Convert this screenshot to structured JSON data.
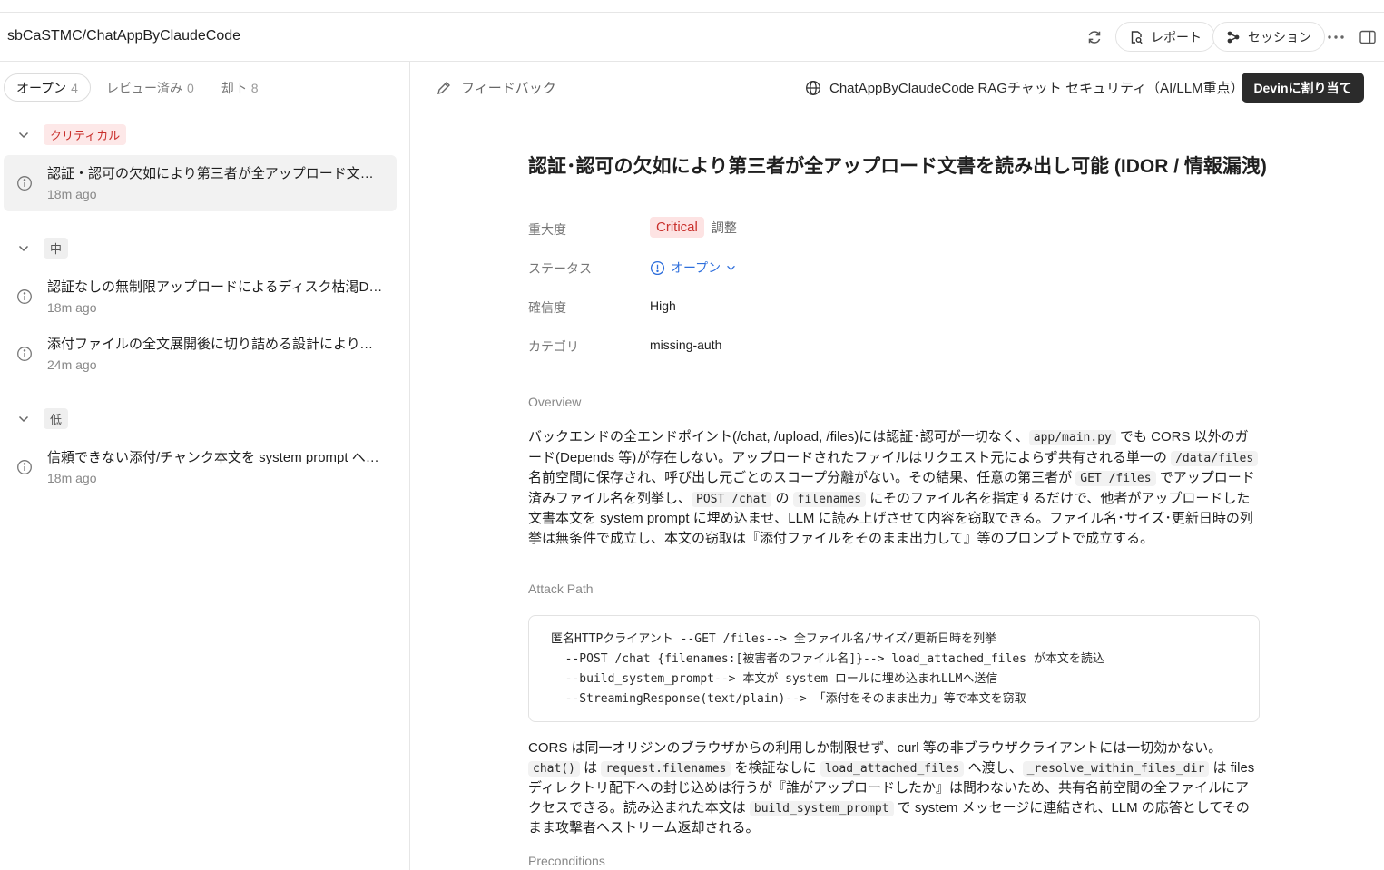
{
  "header": {
    "repo": "sbCaSTMC/ChatAppByClaudeCode",
    "report_label": "レポート",
    "session_label": "セッション"
  },
  "sidebar": {
    "tabs": [
      {
        "label": "オープン",
        "count": "4"
      },
      {
        "label": "レビュー済み",
        "count": "0"
      },
      {
        "label": "却下",
        "count": "8"
      }
    ],
    "groups": [
      {
        "label": "クリティカル",
        "items": [
          {
            "title": "認証・認可の欠如により第三者が全アップロード文書を読み出し可能 (IDOR / 情報漏洩)",
            "time": "18m ago"
          }
        ]
      },
      {
        "label": "中",
        "items": [
          {
            "title": "認証なしの無制限アップロードによるディスク枯渇DoS",
            "time": "18m ago"
          },
          {
            "title": "添付ファイルの全文展開後に切り詰める設計により、細工されたファイルでメモリ枯渇",
            "time": "24m ago"
          }
        ]
      },
      {
        "label": "低",
        "items": [
          {
            "title": "信頼できない添付/チャンク本文を system prompt へ無検証で連結",
            "time": "18m ago"
          }
        ]
      }
    ]
  },
  "main": {
    "feedback_label": "フィードバック",
    "breadcrumb": "ChatAppByClaudeCode RAGチャット セキュリティ（AI/LLM重点）",
    "assign_label": "Devinに割り当て",
    "title": "認証･認可の欠如により第三者が全アップロード文書を読み出し可能 (IDOR / 情報漏洩)",
    "meta": {
      "severity_label": "重大度",
      "severity_value": "Critical",
      "adjust_label": "調整",
      "status_label": "ステータス",
      "status_value": "オープン",
      "confidence_label": "確信度",
      "confidence_value": "High",
      "category_label": "カテゴリ",
      "category_value": "missing-auth"
    },
    "overview_heading": "Overview",
    "overview": {
      "t1": "バックエンドの全エンドポイント(/chat, /upload, /files)には認証･認可が一切なく、",
      "c1": "app/main.py",
      "t2": " でも CORS 以外のガード(Depends 等)が存在しない。アップロードされたファイルはリクエスト元によらず共有される単一の ",
      "c2": "/data/files",
      "t3": " 名前空間に保存され、呼び出し元ごとのスコープ分離がない。その結果、任意の第三者が ",
      "c3": "GET /files",
      "t4": " でアップロード済みファイル名を列挙し、",
      "c4": "POST /chat",
      "t5": " の ",
      "c5": "filenames",
      "t6": " にそのファイル名を指定するだけで、他者がアップロードした文書本文を system prompt に埋め込ませ、LLM に読み上げさせて内容を窃取できる。ファイル名･サイズ･更新日時の列挙は無条件で成立し、本文の窃取は『添付ファイルをそのまま出力して』等のプロンプトで成立する。"
    },
    "attack_heading": "Attack Path",
    "attack_lines": [
      "匿名HTTPクライアント --GET /files--> 全ファイル名/サイズ/更新日時を列挙",
      "  --POST /chat {filenames:[被害者のファイル名]}--> load_attached_files が本文を読込",
      "  --build_system_prompt--> 本文が system ロールに埋め込まれLLMへ送信",
      "  --StreamingResponse(text/plain)--> 「添付をそのまま出力」等で本文を窃取"
    ],
    "attack_desc": {
      "t1": "CORS は同一オリジンのブラウザからの利用しか制限せず、curl 等の非ブラウザクライアントには一切効かない。",
      "c1": "chat()",
      "t2": " は ",
      "c2": "request.filenames",
      "t3": " を検証なしに ",
      "c3": "load_attached_files",
      "t4": " へ渡し、",
      "c4": "_resolve_within_files_dir",
      "t5": " は files ディレクトリ配下への封じ込めは行うが『誰がアップロードしたか』は問わないため、共有名前空間の全ファイルにアクセスできる。読み込まれた本文は ",
      "c5": "build_system_prompt",
      "t6": " で system メッセージに連結され、LLM の応答としてそのまま攻撃者へストリーム返却される。"
    },
    "preconditions_heading": "Preconditions"
  }
}
